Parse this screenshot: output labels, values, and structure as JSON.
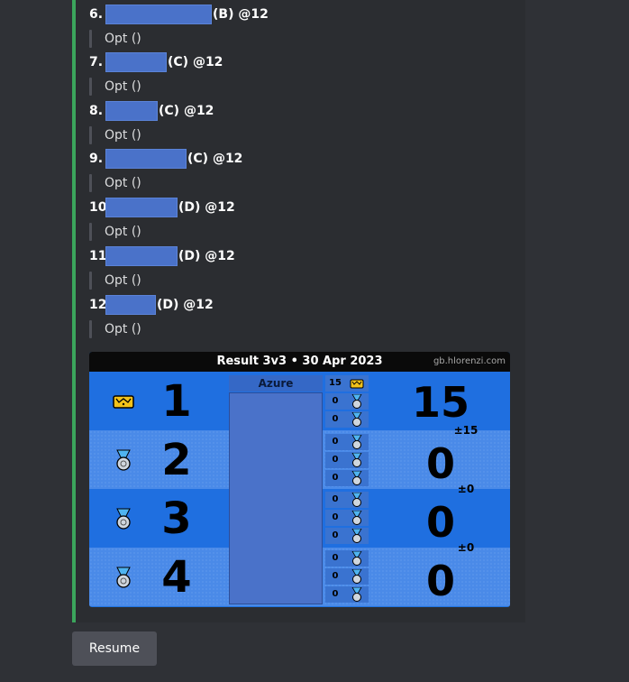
{
  "entries": [
    {
      "num": "6.",
      "suffix": "(B) @12",
      "sub": "Opt ()"
    },
    {
      "num": "7.",
      "suffix": "(C) @12",
      "sub": "Opt ()"
    },
    {
      "num": "8.",
      "suffix": "(C) @12",
      "sub": "Opt ()"
    },
    {
      "num": "9.",
      "suffix": "(C) @12",
      "sub": "Opt ()"
    },
    {
      "num": "10.",
      "suffix": "(D) @12",
      "sub": "Opt ()"
    },
    {
      "num": "11.",
      "suffix": "(D) @12",
      "sub": "Opt ()"
    },
    {
      "num": "12.",
      "suffix": "(D) @12",
      "sub": "Opt ()"
    }
  ],
  "card": {
    "title": "Result 3v3   •   30 Apr 2023",
    "site": "gb.hlorenzi.com",
    "team_name": "Azure",
    "rows": [
      {
        "rank": "1",
        "icon": "crown-icon",
        "score": "15",
        "delta": "±15",
        "players": [
          "15",
          "0",
          "0"
        ]
      },
      {
        "rank": "2",
        "icon": "medal-icon",
        "score": "0",
        "delta": "±0",
        "players": [
          "0",
          "0",
          "0"
        ]
      },
      {
        "rank": "3",
        "icon": "medal-icon",
        "score": "0",
        "delta": "±0",
        "players": [
          "0",
          "0",
          "0"
        ]
      },
      {
        "rank": "4",
        "icon": "medal-icon",
        "score": "0",
        "delta": "",
        "players": [
          "0",
          "0",
          "0"
        ]
      }
    ]
  },
  "resume_label": "Resume",
  "colors": {
    "embed_accent": "#3ba55c",
    "card_blue": "#1f74e0",
    "button": "#4e5058"
  }
}
